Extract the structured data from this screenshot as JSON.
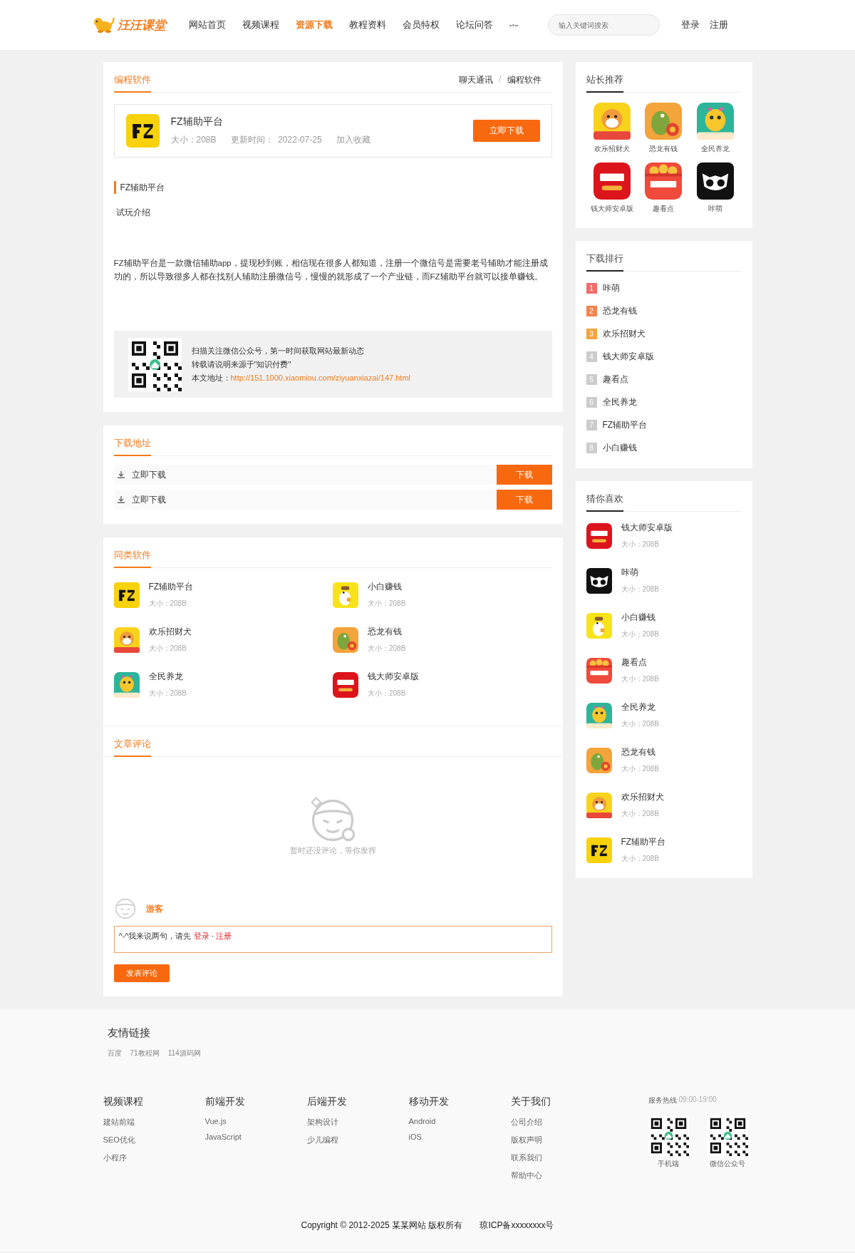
{
  "header": {
    "logo_text": "汪汪课堂",
    "nav": [
      {
        "label": "网站首页",
        "selected": false
      },
      {
        "label": "视频课程",
        "selected": false
      },
      {
        "label": "资源下载",
        "selected": true
      },
      {
        "label": "教程资料",
        "selected": false
      },
      {
        "label": "会员特权",
        "selected": false
      },
      {
        "label": "论坛问答",
        "selected": false
      }
    ],
    "search": {
      "placeholder": "输入关键词搜索"
    },
    "auth": [
      "登录",
      "注册"
    ]
  },
  "article": {
    "category": "编程软件",
    "breadcrumb": [
      "聊天通讯",
      "编程软件"
    ],
    "breadcrumb_separator": "/",
    "app": {
      "name": "FZ辅助平台",
      "kind": "fz",
      "size": "大小：208B",
      "updated_label": "更新时间：",
      "updated": "2022-07-25",
      "favorite": "加入收藏",
      "download": "立即下载"
    },
    "section_title": "FZ辅助平台",
    "subtitle": "试玩介绍",
    "body": "FZ辅助平台是一款微信辅助app，提现秒到账，相信现在很多人都知道，注册一个微信号是需要老号辅助才能注册成功的，所以导致很多人都在找别人辅助注册微信号，慢慢的就形成了一个产业链，而FZ辅助平台就可以接单赚钱。",
    "notice": {
      "lines": [
        "扫描关注微信公众号，第一时间获取网站最新动态",
        "转载请说明来源于\"知识付费\""
      ],
      "address_label": "本文地址：",
      "address": "http://151.1000.xiaomiou.com/ziyuanxiazai/147.html"
    }
  },
  "downloads": {
    "title": "下载地址",
    "rows": [
      {
        "label": "立即下载",
        "button": "下载"
      },
      {
        "label": "立即下载",
        "button": "下载"
      }
    ]
  },
  "similar": {
    "title": "同类软件",
    "items": [
      {
        "name": "FZ辅助平台",
        "size": "大小：208B",
        "kind": "fz"
      },
      {
        "name": "小白赚钱",
        "size": "大小：208B",
        "kind": "duck"
      },
      {
        "name": "欢乐招财犬",
        "size": "大小：208B",
        "kind": "dog"
      },
      {
        "name": "恐龙有钱",
        "size": "大小：208B",
        "kind": "dino"
      },
      {
        "name": "全民养龙",
        "size": "大小：208B",
        "kind": "dragon"
      },
      {
        "name": "钱大师安卓版",
        "size": "大小：208B",
        "kind": "money"
      }
    ]
  },
  "comments": {
    "title": "文章评论",
    "empty": "暂时还没评论，等你发挥",
    "user": "游客",
    "input_prefix": "^-^我来说两句，请先",
    "login": "登录",
    "separator": "·",
    "register": "注册",
    "submit": "发表评论"
  },
  "sidebar": {
    "recommend": {
      "title": "站长推荐",
      "items": [
        {
          "name": "欢乐招财犬",
          "kind": "dog"
        },
        {
          "name": "恐龙有钱",
          "kind": "dino"
        },
        {
          "name": "全民养龙",
          "kind": "dragon"
        },
        {
          "name": "钱大师安卓版",
          "kind": "money"
        },
        {
          "name": "趣看点",
          "kind": "reader"
        },
        {
          "name": "咔萌",
          "kind": "owl"
        }
      ]
    },
    "ranking": {
      "title": "下载排行",
      "items": [
        {
          "rank": "1",
          "name": "咔萌",
          "color": "#f26b6b"
        },
        {
          "rank": "2",
          "name": "恐龙有钱",
          "color": "#f5834b"
        },
        {
          "rank": "3",
          "name": "欢乐招财犬",
          "color": "#f7a33c"
        },
        {
          "rank": "4",
          "name": "钱大师安卓版",
          "color": "#cccccc"
        },
        {
          "rank": "5",
          "name": "趣看点",
          "color": "#cccccc"
        },
        {
          "rank": "6",
          "name": "全民养龙",
          "color": "#cccccc"
        },
        {
          "rank": "7",
          "name": "FZ辅助平台",
          "color": "#cccccc"
        },
        {
          "rank": "8",
          "name": "小白赚钱",
          "color": "#cccccc"
        }
      ]
    },
    "likes": {
      "title": "猜你喜欢",
      "items": [
        {
          "name": "钱大师安卓版",
          "size": "大小：208B",
          "kind": "money"
        },
        {
          "name": "咔萌",
          "size": "大小：208B",
          "kind": "owl"
        },
        {
          "name": "小白赚钱",
          "size": "大小：208B",
          "kind": "duck"
        },
        {
          "name": "趣看点",
          "size": "大小：208B",
          "kind": "reader"
        },
        {
          "name": "全民养龙",
          "size": "大小：208B",
          "kind": "dragon"
        },
        {
          "name": "恐龙有钱",
          "size": "大小：208B",
          "kind": "dino"
        },
        {
          "name": "欢乐招财犬",
          "size": "大小：208B",
          "kind": "dog"
        },
        {
          "name": "FZ辅助平台",
          "size": "大小：208B",
          "kind": "fz"
        }
      ]
    }
  },
  "footer": {
    "links_title": "友情链接",
    "links": [
      "百度",
      "71教程网",
      "114源码网"
    ],
    "columns": [
      {
        "title": "视频课程",
        "items": [
          "建站前端",
          "SEO优化",
          "小程序"
        ]
      },
      {
        "title": "前端开发",
        "items": [
          "Vue.js",
          "JavaScript"
        ]
      },
      {
        "title": "后端开发",
        "items": [
          "架构设计",
          "少儿编程"
        ]
      },
      {
        "title": "移动开发",
        "items": [
          "Android",
          "iOS"
        ]
      },
      {
        "title": "关于我们",
        "items": [
          "公司介绍",
          "版权声明",
          "联系我们",
          "帮助中心"
        ]
      }
    ],
    "hotline_label": "服务热线",
    "hotline_hours": "09:00-19:00",
    "qr_codes": [
      "手机端",
      "微信公众号"
    ],
    "copyright": "Copyright © 2012-2025 某某网站 版权所有",
    "icp": "琼ICP备xxxxxxxx号"
  }
}
